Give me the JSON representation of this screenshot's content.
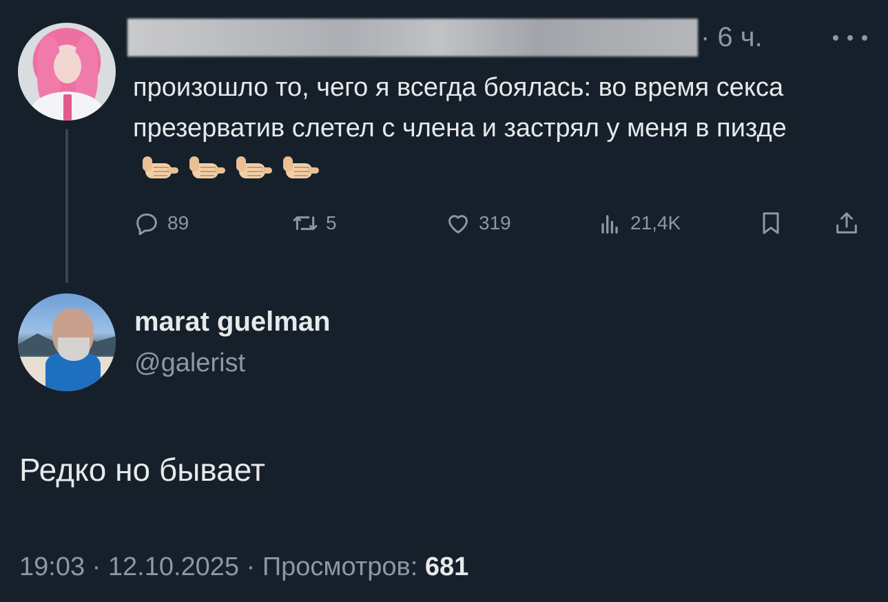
{
  "parent_tweet": {
    "author_name_redacted": true,
    "time": "· 6 ч.",
    "text": "произошло то, чего я всегда боялась: во время секса презерватив слетел с члена и застрял у меня в пизде",
    "emoji_name": "call-me-hand-light-skin-tone",
    "emoji_count": 4,
    "stats": {
      "replies": "89",
      "retweets": "5",
      "likes": "319",
      "views": "21,4K"
    },
    "icons": [
      "reply-icon",
      "retweet-icon",
      "like-icon",
      "views-icon",
      "bookmark-icon",
      "share-icon"
    ]
  },
  "reply_tweet": {
    "display_name": "marat guelman",
    "handle": "@galerist",
    "text": "Редко но бывает",
    "time": "19:03",
    "date": "12.10.2025",
    "views_label": "Просмотров:",
    "views": "681"
  },
  "colors": {
    "background": "#15202b",
    "text_primary": "#e7e9ea",
    "text_secondary": "#8b98a5",
    "thread_line": "#38444d"
  }
}
